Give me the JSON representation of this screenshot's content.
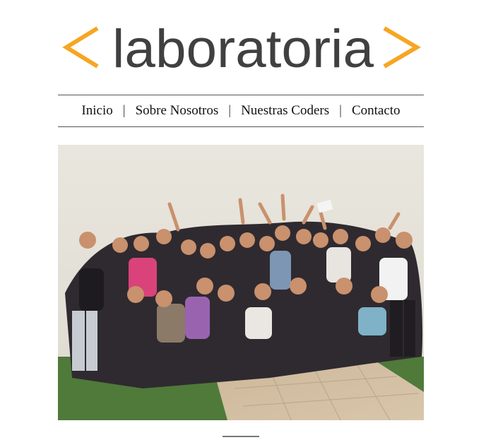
{
  "logo": {
    "text": "laboratoria",
    "accent_color": "#f6a623",
    "text_color": "#404040"
  },
  "nav": {
    "items": [
      {
        "label": "Inicio"
      },
      {
        "label": "Sobre Nosotros"
      },
      {
        "label": "Nuestras Coders"
      },
      {
        "label": "Contacto"
      }
    ],
    "separator": "|"
  },
  "photo": {
    "subject_icon": "group-photo-image"
  }
}
